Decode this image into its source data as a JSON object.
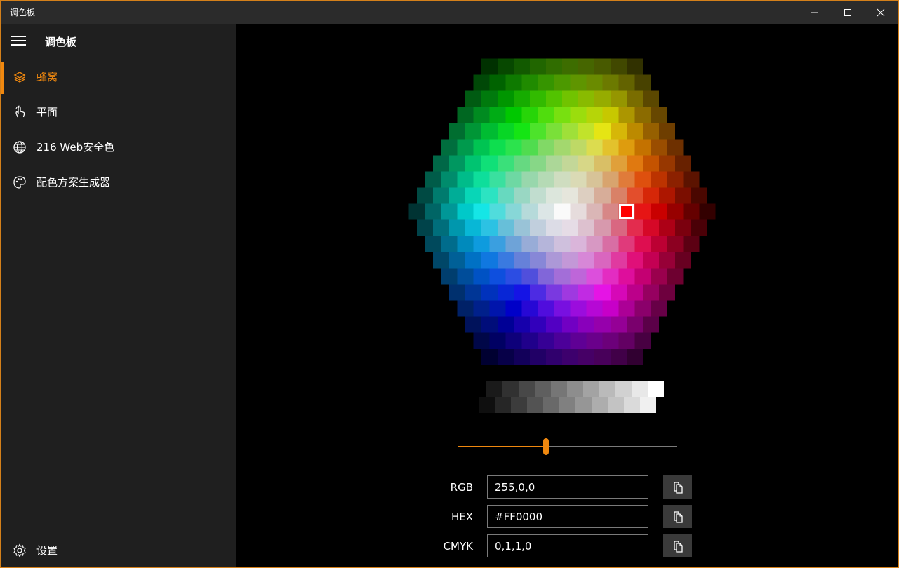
{
  "window": {
    "title": "调色板",
    "accent": "#f0880f"
  },
  "sidebar": {
    "app_title": "调色板",
    "items": [
      {
        "label": "蜂窝",
        "icon": "layers-icon",
        "active": true
      },
      {
        "label": "平面",
        "icon": "touch-hand-icon",
        "active": false
      },
      {
        "label": "216 Web安全色",
        "icon": "globe-icon",
        "active": false
      },
      {
        "label": "配色方案生成器",
        "icon": "palette-icon",
        "active": false
      }
    ],
    "settings_label": "设置"
  },
  "picker": {
    "selected_color": "#FF0000",
    "brightness_slider": 0.4
  },
  "fields": [
    {
      "label": "RGB",
      "value": "255,0,0"
    },
    {
      "label": "HEX",
      "value": "#FF0000"
    },
    {
      "label": "CMYK",
      "value": "0,1,1,0"
    }
  ]
}
